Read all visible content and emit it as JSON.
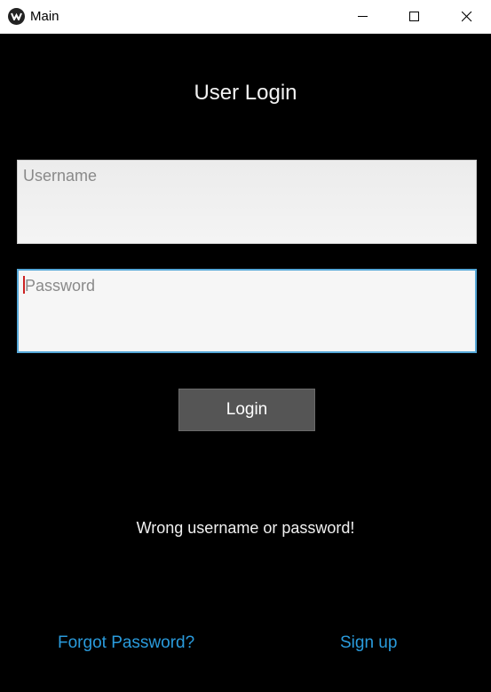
{
  "window": {
    "title": "Main",
    "app_icon": "kivy-logo-icon",
    "controls": [
      "minimize-icon",
      "maximize-icon",
      "close-icon"
    ]
  },
  "login": {
    "heading": "User Login",
    "username": {
      "value": "",
      "placeholder": "Username"
    },
    "password": {
      "value": "",
      "placeholder": "Password"
    },
    "login_button": "Login",
    "error_message": "Wrong username or password!",
    "forgot_link": "Forgot Password?",
    "signup_link": "Sign up"
  },
  "colors": {
    "background": "#000000",
    "link": "#2a9bdc",
    "focus_border": "#56a8d8",
    "button": "#555555"
  }
}
